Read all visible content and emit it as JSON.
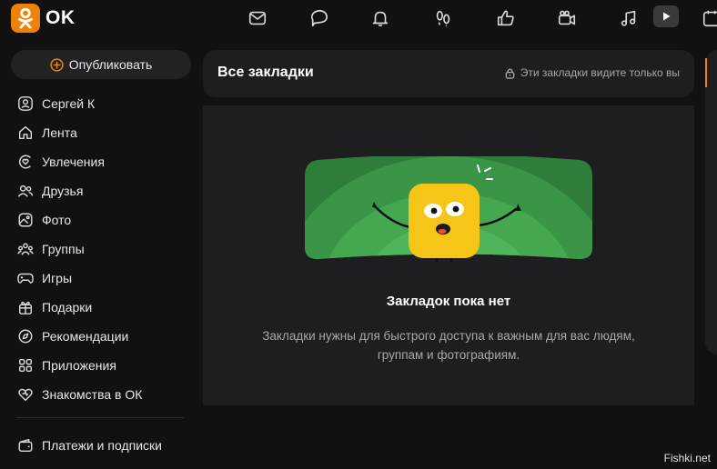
{
  "header": {
    "logo_text": "OK",
    "brand_color": "#ee8208",
    "nav": [
      {
        "name": "messages-icon"
      },
      {
        "name": "discussions-icon"
      },
      {
        "name": "notifications-icon"
      },
      {
        "name": "guests-icon"
      },
      {
        "name": "likes-icon"
      },
      {
        "name": "video-icon"
      },
      {
        "name": "music-icon"
      },
      {
        "name": "play-icon"
      },
      {
        "name": "calendar-icon"
      }
    ]
  },
  "sidebar": {
    "publish_label": "Опубликовать",
    "items": [
      {
        "label": "Сергей К",
        "icon": "user-icon"
      },
      {
        "label": "Лента",
        "icon": "home-icon"
      },
      {
        "label": "Увлечения",
        "icon": "hobbies-icon"
      },
      {
        "label": "Друзья",
        "icon": "friends-icon"
      },
      {
        "label": "Фото",
        "icon": "photo-icon"
      },
      {
        "label": "Группы",
        "icon": "groups-icon"
      },
      {
        "label": "Игры",
        "icon": "games-icon"
      },
      {
        "label": "Подарки",
        "icon": "gift-icon"
      },
      {
        "label": "Рекомендации",
        "icon": "compass-icon"
      },
      {
        "label": "Приложения",
        "icon": "apps-icon"
      },
      {
        "label": "Знакомства в ОК",
        "icon": "heart-icon"
      },
      {
        "label": "Платежи и подписки",
        "icon": "wallet-icon"
      }
    ]
  },
  "main": {
    "title": "Все закладки",
    "privacy_note": "Эти закладки видите только вы",
    "empty_title": "Закладок пока нет",
    "empty_description": "Закладки нужны для быстрого доступа к важным для вас людям, группам и фотографиям."
  },
  "watermark": "Fishki.net"
}
